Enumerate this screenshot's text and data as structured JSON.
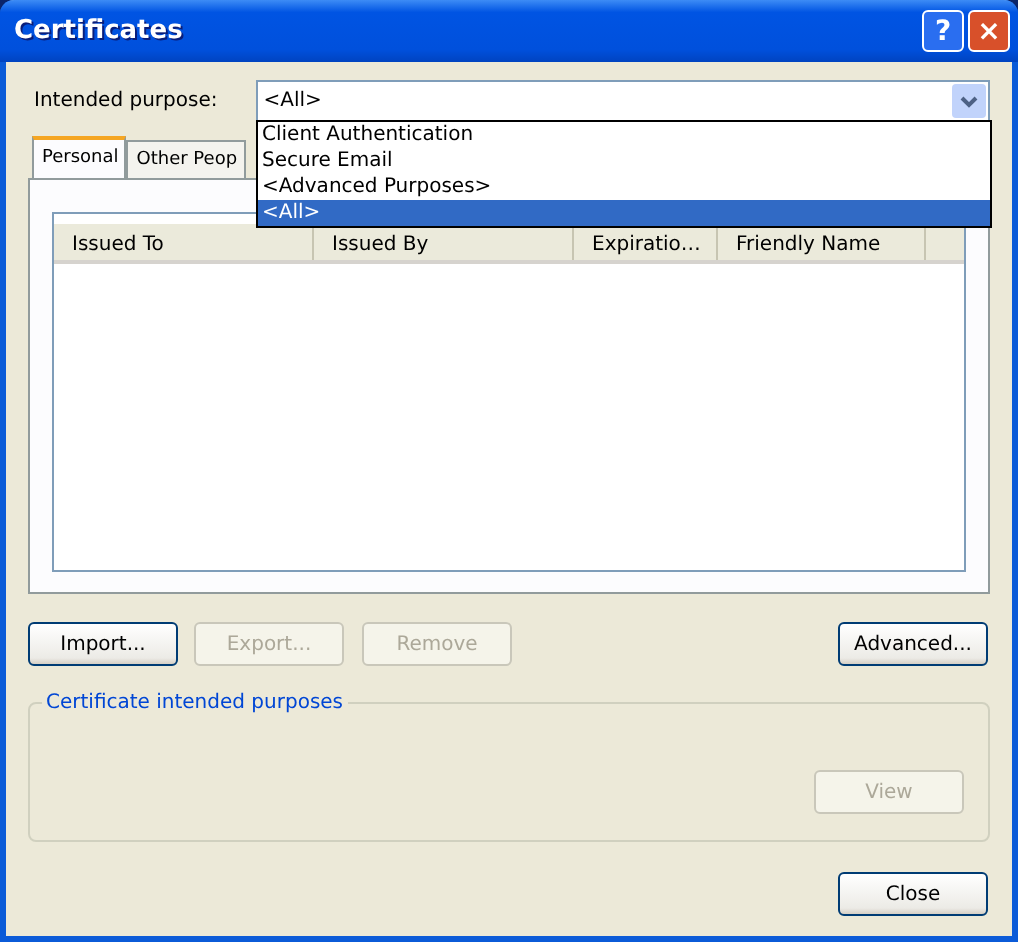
{
  "window": {
    "title": "Certificates",
    "buttons": [
      "?",
      "×"
    ]
  },
  "purpose": {
    "label": "Intended purpose:",
    "value": "<All>",
    "expanded": true,
    "options": [
      {
        "label": "Client Authentication",
        "selected": false
      },
      {
        "label": "Secure Email",
        "selected": false
      },
      {
        "label": "<Advanced Purposes>",
        "selected": false
      },
      {
        "label": "<All>",
        "selected": true
      }
    ]
  },
  "tabs": [
    {
      "label": "Personal",
      "selected": true
    },
    {
      "label": "Other Peop",
      "selected": false
    }
  ],
  "table": {
    "columns": [
      "Issued To",
      "Issued By",
      "Expiratio…",
      "Friendly Name"
    ]
  },
  "actions": [
    {
      "label": "Import...",
      "disabled": false
    },
    {
      "label": "Export...",
      "disabled": true
    },
    {
      "label": "Remove",
      "disabled": true
    }
  ],
  "advanced_button": {
    "label": "Advanced...",
    "disabled": false
  },
  "group": {
    "title": "Certificate intended purposes",
    "button": {
      "label": "View",
      "disabled": true
    }
  },
  "close_button": {
    "label": "Close",
    "disabled": false
  }
}
